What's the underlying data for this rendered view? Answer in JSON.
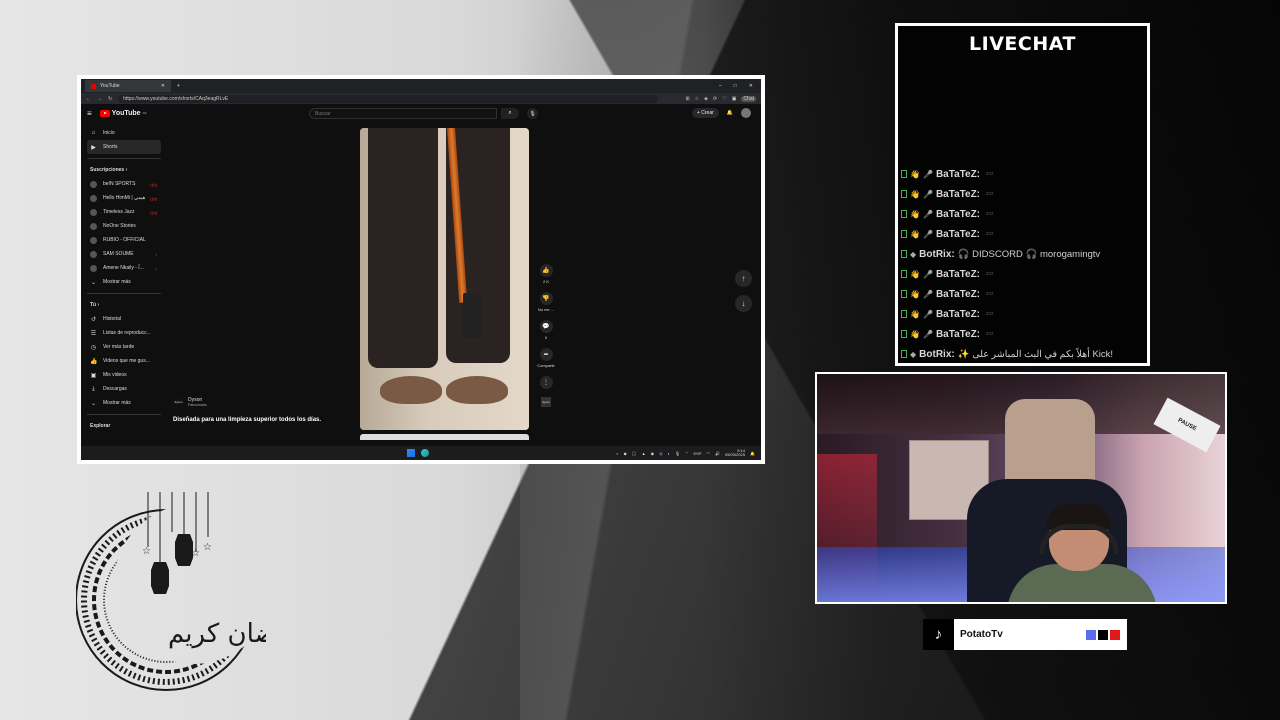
{
  "browser": {
    "tab_title": "YouTube",
    "url": "https://www.youtube.com/shorts/CAq3eagRLvE",
    "chat_label": "Chat"
  },
  "youtube": {
    "logo": "YouTube",
    "logo_region": "DZ",
    "search_placeholder": "Buscar",
    "create_label": "+ Crear",
    "nav": [
      {
        "label": "Inicio",
        "icon": "home-icon"
      },
      {
        "label": "Shorts",
        "icon": "shorts-icon"
      }
    ],
    "subs_heading": "Suscripciones",
    "subscriptions": [
      {
        "label": "beIN SPORTS",
        "live": "((•))"
      },
      {
        "label": "Hello HimMi | هيمي",
        "live": "((•))"
      },
      {
        "label": "Timeless Jazz",
        "live": "((•))"
      },
      {
        "label": "NoOne Stories",
        "live": ""
      },
      {
        "label": "RUBIO - OFFICIAL",
        "live": ""
      },
      {
        "label": "SAM SOUME",
        "live": "•"
      },
      {
        "label": "Amene Nkaily - آ...",
        "live": "•"
      }
    ],
    "show_more": "Mostrar más",
    "you_heading": "Tú",
    "you_items": [
      {
        "label": "Historial",
        "icon": "history-icon"
      },
      {
        "label": "Listas de reproducc...",
        "icon": "playlist-icon"
      },
      {
        "label": "Ver más tarde",
        "icon": "clock-icon"
      },
      {
        "label": "Videos que me gus...",
        "icon": "thumbs-up-icon"
      },
      {
        "label": "Mis videos",
        "icon": "video-icon"
      },
      {
        "label": "Descargas",
        "icon": "download-icon"
      }
    ],
    "show_more_2": "Mostrar más",
    "explore_heading": "Explorar",
    "actions": {
      "likes": "2 K",
      "dislike": "No me ...",
      "comments": "0",
      "share": "Compartir"
    },
    "brand_thumb": "dyson",
    "channel": "Dyson",
    "sponsored": "Patrocinado",
    "caption": "Diseñada para una limpieza superior todos los días."
  },
  "taskbar": {
    "lang": "ESP",
    "time": "5:14",
    "date": "05/03/2025"
  },
  "livechat": {
    "title": "LIVECHAT",
    "messages": [
      {
        "user": "BaTaTeZ:",
        "text": "",
        "emote": "zzz",
        "badge": "mic"
      },
      {
        "user": "BaTaTeZ:",
        "text": "",
        "emote": "zzz",
        "badge": "mic"
      },
      {
        "user": "BaTaTeZ:",
        "text": "",
        "emote": "zzz",
        "badge": "mic"
      },
      {
        "user": "BaTaTeZ:",
        "text": "",
        "emote": "zzz",
        "badge": "mic"
      },
      {
        "user": "BotRix:",
        "text": "🎧 DIDSCORD 🎧 morogamingtv",
        "emote": "",
        "badge": "diamond"
      },
      {
        "user": "BaTaTeZ:",
        "text": "",
        "emote": "zzz",
        "badge": "mic"
      },
      {
        "user": "BaTaTeZ:",
        "text": "",
        "emote": "zzz",
        "badge": "mic"
      },
      {
        "user": "BaTaTeZ:",
        "text": "",
        "emote": "zzz",
        "badge": "mic"
      },
      {
        "user": "BaTaTeZ:",
        "text": "",
        "emote": "zzz",
        "badge": "mic"
      },
      {
        "user": "BotRix:",
        "text": "✨ أهلاً بكم في البث المباشر على Kick!",
        "emote": "",
        "badge": "diamond"
      }
    ]
  },
  "tiktok": {
    "handle": "PotatoTv",
    "colors": [
      "#5b6cf0",
      "#000000",
      "#e01a1a"
    ]
  },
  "overlay": {
    "ramadan_text": "رمضان كريم"
  }
}
